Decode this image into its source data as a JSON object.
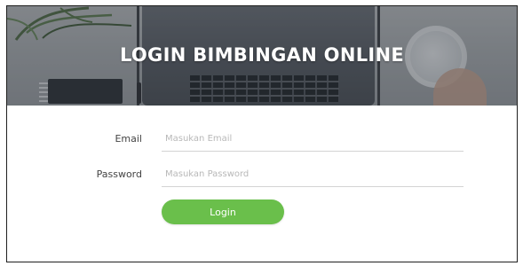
{
  "header": {
    "title": "LOGIN BIMBINGAN ONLINE",
    "background_icons": [
      "plant-icon",
      "laptop-icon",
      "notebook-icon",
      "pen-icon",
      "mug-icon"
    ]
  },
  "form": {
    "email": {
      "label": "Email",
      "placeholder": "Masukan Email",
      "value": ""
    },
    "password": {
      "label": "Password",
      "placeholder": "Masukan Password",
      "value": ""
    },
    "submit_label": "Login"
  },
  "colors": {
    "accent": "#6abf4b",
    "title_text": "#ffffff",
    "label_text": "#444444",
    "placeholder_text": "#b8b8b8",
    "frame_border": "#1f1f1f"
  }
}
